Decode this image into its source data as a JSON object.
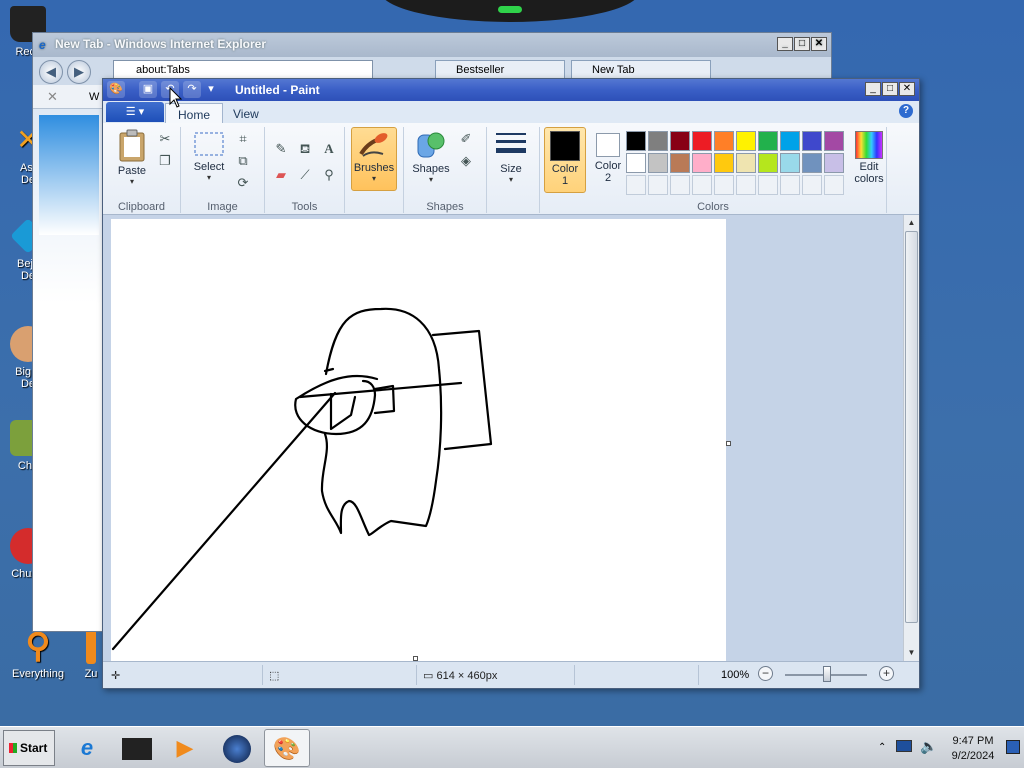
{
  "desktop": {
    "icons": [
      {
        "label": "Recy",
        "color": "#222222"
      },
      {
        "label": "Ast\nDe",
        "color": "#f0a020"
      },
      {
        "label": "Beje\nDe",
        "color": "#1a9ad6"
      },
      {
        "label": "Big F\nDe",
        "color": "#d9a070"
      },
      {
        "label": "Cho",
        "color": "#7ca03c"
      },
      {
        "label": "Chuzzl",
        "color": "#d42c2c"
      },
      {
        "label": "Everything",
        "color": "#f08a1c"
      },
      {
        "label": "Zu",
        "color": "#f08a1c"
      }
    ]
  },
  "ie": {
    "title": "New Tab - Windows Internet Explorer",
    "address": "about:Tabs",
    "tabs": [
      "Bestseller",
      "New Tab"
    ],
    "command_fragment": "W"
  },
  "paint": {
    "title": "Untitled - Paint",
    "file_menu_icon": "menu-icon",
    "tabs": [
      "Home",
      "View"
    ],
    "clipboard": {
      "paste": "Paste",
      "label": "Clipboard"
    },
    "image": {
      "select": "Select",
      "label": "Image"
    },
    "tools": {
      "label": "Tools"
    },
    "brushes": "Brushes",
    "shapes": {
      "button": "Shapes",
      "label": "Shapes"
    },
    "size": "Size",
    "color1": {
      "line1": "Color",
      "line2": "1",
      "value": "#000000"
    },
    "color2": {
      "line1": "Color",
      "line2": "2",
      "value": "#ffffff"
    },
    "colors_label": "Colors",
    "edit_colors": {
      "line1": "Edit",
      "line2": "colors"
    },
    "palette_row1": [
      "#000000",
      "#7f7f7f",
      "#880015",
      "#ed1c24",
      "#ff7f27",
      "#fff200",
      "#22b14c",
      "#00a2e8",
      "#3f48cc",
      "#a349a4"
    ],
    "palette_row2": [
      "#ffffff",
      "#c3c3c3",
      "#b97a57",
      "#ffaec9",
      "#ffc90e",
      "#efe4b0",
      "#b5e61d",
      "#99d9ea",
      "#7092be",
      "#c8bfe7"
    ],
    "status": {
      "dimensions": "614 × 460px",
      "zoom": "100%"
    }
  },
  "taskbar": {
    "start": "Start",
    "time": "9:47 PM",
    "date": "9/2/2024"
  }
}
